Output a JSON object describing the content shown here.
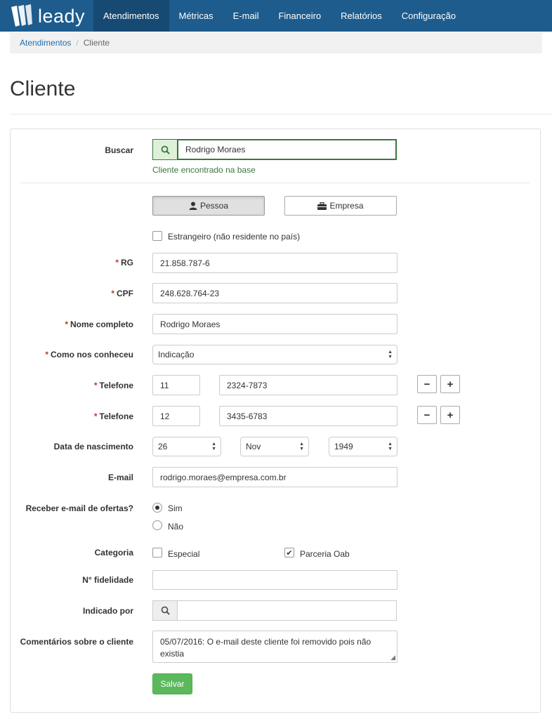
{
  "brand": {
    "name": "leady"
  },
  "nav": {
    "items": [
      "Atendimentos",
      "Métricas",
      "E-mail",
      "Financeiro",
      "Relatórios",
      "Configuração"
    ]
  },
  "breadcrumb": {
    "parent": "Atendimentos",
    "separator": "/",
    "current": "Cliente"
  },
  "page": {
    "title": "Cliente"
  },
  "form": {
    "buscar": {
      "label": "Buscar",
      "value": "Rodrigo Moraes",
      "help": "Cliente encontrado na base"
    },
    "tipo": {
      "pessoa": "Pessoa",
      "empresa": "Empresa",
      "selected": "Pessoa"
    },
    "estrangeiro": {
      "label": "Estrangeiro (não residente no país)",
      "checked": false
    },
    "rg": {
      "label": "RG",
      "value": "21.858.787-6"
    },
    "cpf": {
      "label": "CPF",
      "value": "248.628.764-23"
    },
    "nome": {
      "label": "Nome completo",
      "value": "Rodrigo Moraes"
    },
    "como": {
      "label": "Como nos conheceu",
      "value": "Indicação"
    },
    "telefones": [
      {
        "label": "Telefone",
        "ddd": "11",
        "numero": "2324-7873"
      },
      {
        "label": "Telefone",
        "ddd": "12",
        "numero": "3435-6783"
      }
    ],
    "nascimento": {
      "label": "Data de nascimento",
      "dia": "26",
      "mes": "Nov",
      "ano": "1949"
    },
    "email": {
      "label": "E-mail",
      "value": "rodrigo.moraes@empresa.com.br"
    },
    "ofertas": {
      "label": "Receber e-mail de ofertas?",
      "sim": "Sim",
      "nao": "Não",
      "selected": "Sim"
    },
    "categoria": {
      "label": "Categoria",
      "especial": "Especial",
      "especial_checked": false,
      "parceria": "Parceria Oab",
      "parceria_checked": true
    },
    "fidelidade": {
      "label": "N° fidelidade",
      "value": ""
    },
    "indicado": {
      "label": "Indicado por",
      "value": ""
    },
    "comentarios": {
      "label": "Comentários sobre o cliente",
      "value": "05/07/2016: O e-mail deste cliente foi removido pois não existia"
    },
    "salvar": "Salvar"
  },
  "colors": {
    "navbar": "#1d5c8d",
    "success": "#3c763d",
    "save": "#5cb85c",
    "required": "#c0392b"
  }
}
